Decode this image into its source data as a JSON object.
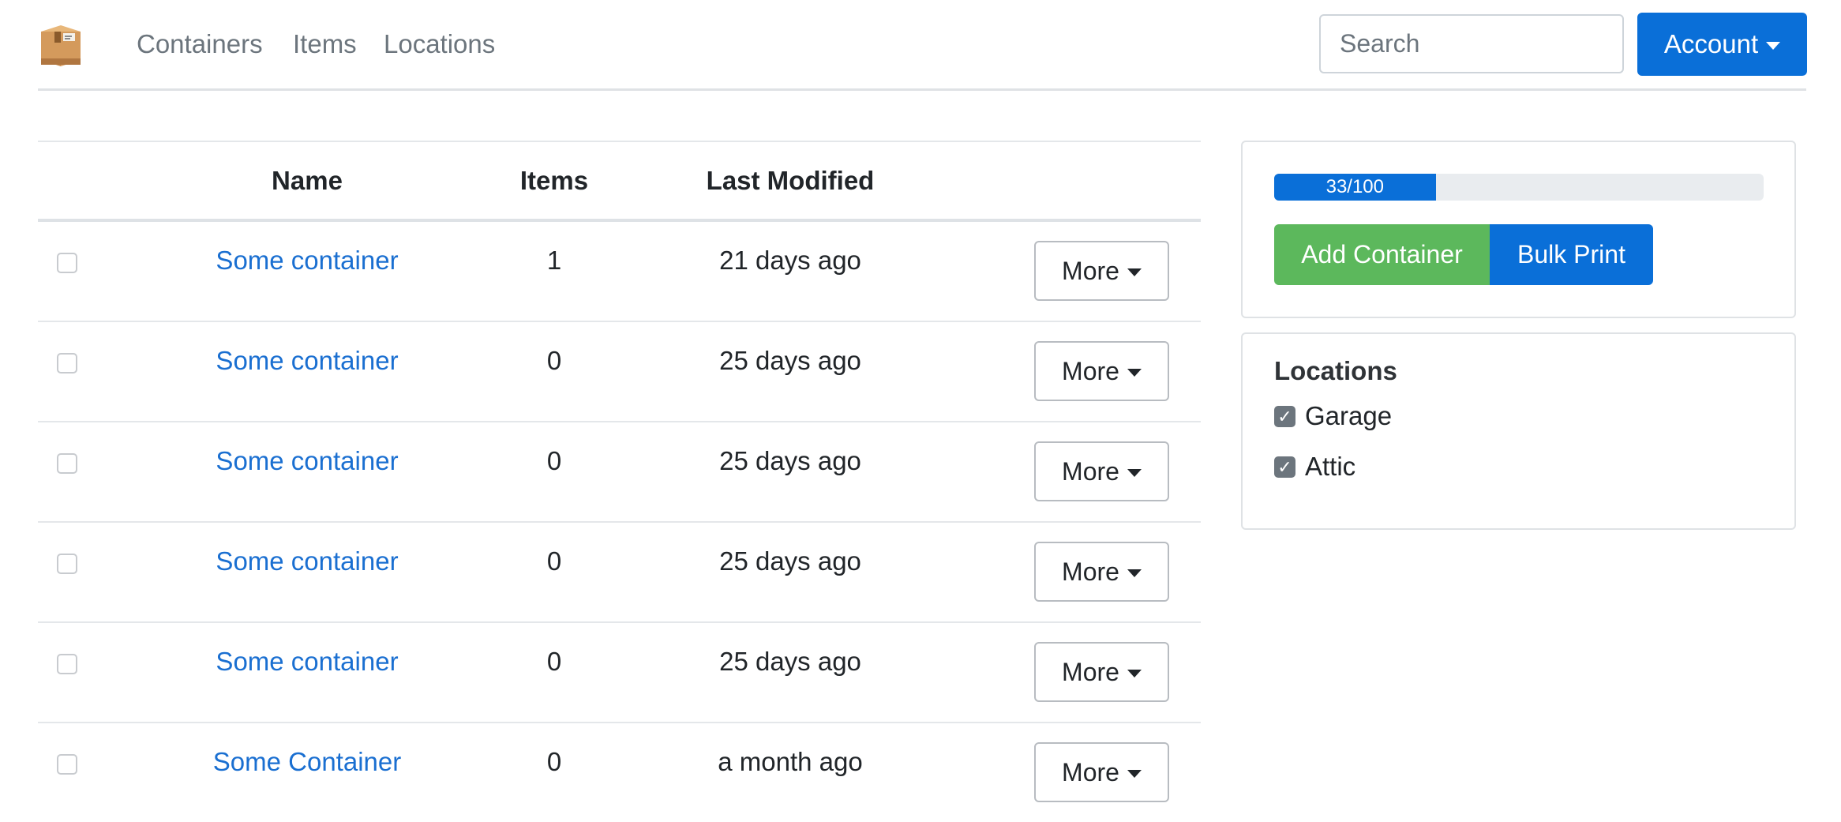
{
  "nav": {
    "logo_icon": "box-icon",
    "links": [
      "Containers",
      "Items",
      "Locations"
    ],
    "search_placeholder": "Search",
    "account_label": "Account"
  },
  "table": {
    "headers": {
      "name": "Name",
      "items": "Items",
      "last_modified": "Last Modified"
    },
    "more_label": "More",
    "rows": [
      {
        "name": "Some container",
        "items": "1",
        "last_modified": "21 days ago",
        "checked": false
      },
      {
        "name": "Some container",
        "items": "0",
        "last_modified": "25 days ago",
        "checked": false
      },
      {
        "name": "Some container",
        "items": "0",
        "last_modified": "25 days ago",
        "checked": false
      },
      {
        "name": "Some container",
        "items": "0",
        "last_modified": "25 days ago",
        "checked": false
      },
      {
        "name": "Some container",
        "items": "0",
        "last_modified": "25 days ago",
        "checked": false
      },
      {
        "name": "Some Container",
        "items": "0",
        "last_modified": "a month ago",
        "checked": false
      }
    ]
  },
  "actions": {
    "progress_label": "33/100",
    "progress_fraction": 0.33,
    "add_container_label": "Add Container",
    "bulk_print_label": "Bulk Print"
  },
  "locations": {
    "title": "Locations",
    "items": [
      {
        "label": "Garage",
        "checked": true
      },
      {
        "label": "Attic",
        "checked": true
      }
    ]
  },
  "colors": {
    "primary": "#0a6fd8",
    "success": "#5cb85c",
    "link": "#1a6fd1"
  }
}
